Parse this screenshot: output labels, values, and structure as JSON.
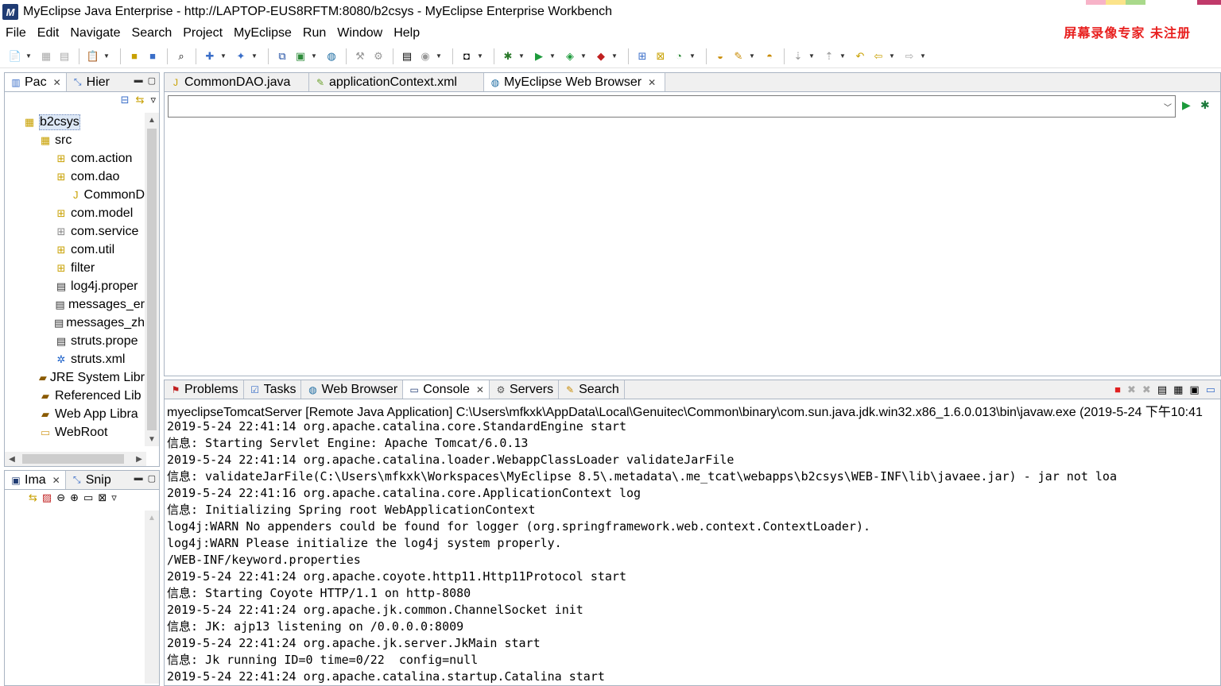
{
  "window": {
    "title": "MyEclipse Java Enterprise - http://LAPTOP-EUS8RFTM:8080/b2csys - MyEclipse Enterprise Workbench",
    "watermark": "屏幕录像专家  未注册"
  },
  "menu": [
    "File",
    "Edit",
    "Navigate",
    "Search",
    "Project",
    "MyEclipse",
    "Run",
    "Window",
    "Help"
  ],
  "package_explorer": {
    "tabs": [
      {
        "label": "Pac",
        "icon": "package-explorer-icon",
        "active": true
      },
      {
        "label": "Hier",
        "icon": "hierarchy-icon",
        "active": false
      }
    ],
    "tree": [
      {
        "label": "b2csys",
        "depth": 0,
        "icon": "project-icon",
        "selected": true
      },
      {
        "label": "src",
        "depth": 1,
        "icon": "source-folder-icon"
      },
      {
        "label": "com.action",
        "depth": 2,
        "icon": "package-icon"
      },
      {
        "label": "com.dao",
        "depth": 2,
        "icon": "package-icon"
      },
      {
        "label": "CommonD",
        "depth": 3,
        "icon": "java-file-icon"
      },
      {
        "label": "com.model",
        "depth": 2,
        "icon": "package-icon"
      },
      {
        "label": "com.service",
        "depth": 2,
        "icon": "empty-package-icon"
      },
      {
        "label": "com.util",
        "depth": 2,
        "icon": "package-icon"
      },
      {
        "label": "filter",
        "depth": 2,
        "icon": "package-icon"
      },
      {
        "label": "log4j.proper",
        "depth": 2,
        "icon": "properties-file-icon"
      },
      {
        "label": "messages_er",
        "depth": 2,
        "icon": "properties-file-icon"
      },
      {
        "label": "messages_zh",
        "depth": 2,
        "icon": "properties-file-icon"
      },
      {
        "label": "struts.prope",
        "depth": 2,
        "icon": "properties-file-icon"
      },
      {
        "label": "struts.xml",
        "depth": 2,
        "icon": "struts-config-icon"
      },
      {
        "label": "JRE System Libr",
        "depth": 1,
        "icon": "library-icon"
      },
      {
        "label": "Referenced Lib",
        "depth": 1,
        "icon": "library-icon"
      },
      {
        "label": "Web App Libra",
        "depth": 1,
        "icon": "library-icon"
      },
      {
        "label": "WebRoot",
        "depth": 1,
        "icon": "folder-icon"
      }
    ]
  },
  "image_panel": {
    "tabs": [
      {
        "label": "Ima",
        "icon": "image-viewer-icon",
        "active": true
      },
      {
        "label": "Snip",
        "icon": "snippets-icon",
        "active": false
      }
    ]
  },
  "editor": {
    "tabs": [
      {
        "label": "CommonDAO.java",
        "icon": "java-file-icon",
        "active": false
      },
      {
        "label": "applicationContext.xml",
        "icon": "spring-xml-icon",
        "active": false
      },
      {
        "label": "MyEclipse Web Browser",
        "icon": "web-browser-icon",
        "active": true
      }
    ],
    "url_value": ""
  },
  "console": {
    "tabs": [
      {
        "label": "Problems",
        "icon": "problems-icon",
        "active": false
      },
      {
        "label": "Tasks",
        "icon": "tasks-icon",
        "active": false
      },
      {
        "label": "Web Browser",
        "icon": "web-browser-icon",
        "active": false
      },
      {
        "label": "Console",
        "icon": "console-icon",
        "active": true
      },
      {
        "label": "Servers",
        "icon": "servers-icon",
        "active": false
      },
      {
        "label": "Search",
        "icon": "search-icon",
        "active": false
      }
    ],
    "header": "myeclipseTomcatServer [Remote Java Application] C:\\Users\\mfkxk\\AppData\\Local\\Genuitec\\Common\\binary\\com.sun.java.jdk.win32.x86_1.6.0.013\\bin\\javaw.exe (2019-5-24 下午10:41",
    "lines": [
      "2019-5-24 22:41:14 org.apache.catalina.core.StandardEngine start",
      "信息: Starting Servlet Engine: Apache Tomcat/6.0.13",
      "2019-5-24 22:41:14 org.apache.catalina.loader.WebappClassLoader validateJarFile",
      "信息: validateJarFile(C:\\Users\\mfkxk\\Workspaces\\MyEclipse 8.5\\.metadata\\.me_tcat\\webapps\\b2csys\\WEB-INF\\lib\\javaee.jar) - jar not loa",
      "2019-5-24 22:41:16 org.apache.catalina.core.ApplicationContext log",
      "信息: Initializing Spring root WebApplicationContext",
      "log4j:WARN No appenders could be found for logger (org.springframework.web.context.ContextLoader).",
      "log4j:WARN Please initialize the log4j system properly.",
      "/WEB-INF/keyword.properties",
      "2019-5-24 22:41:24 org.apache.coyote.http11.Http11Protocol start",
      "信息: Starting Coyote HTTP/1.1 on http-8080",
      "2019-5-24 22:41:24 org.apache.jk.common.ChannelSocket init",
      "信息: JK: ajp13 listening on /0.0.0.0:8009",
      "2019-5-24 22:41:24 org.apache.jk.server.JkMain start",
      "信息: Jk running ID=0 time=0/22  config=null",
      "2019-5-24 22:41:24 org.apache.catalina.startup.Catalina start"
    ]
  },
  "colors": {
    "accent_blue": "#1f3b73",
    "watermark_red": "#e8201f",
    "panel_border": "#a9b4c2",
    "selection": "#dde8f6"
  }
}
